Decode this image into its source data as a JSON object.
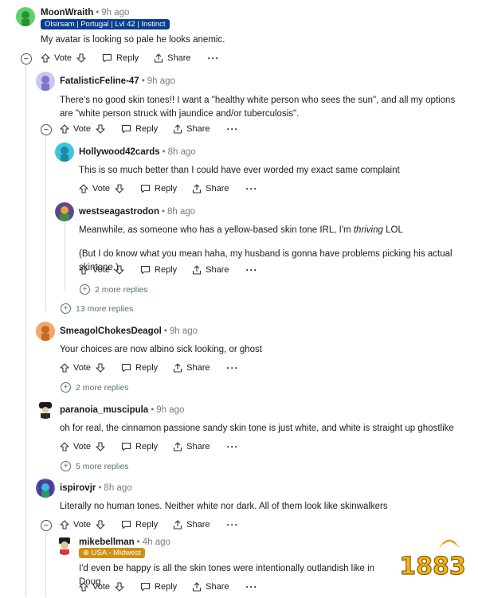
{
  "actions": {
    "vote": "Vote",
    "reply": "Reply",
    "share": "Share",
    "more": "···"
  },
  "comments": [
    {
      "user": "MoonWraith",
      "time": "9h ago",
      "flair": "Olsirsam | Portugal | Lvl 42 | Instinct",
      "text": [
        "My avatar is looking so pale he looks anemic."
      ]
    },
    {
      "user": "FatalisticFeline-47",
      "time": "9h ago",
      "text": [
        "There's no good skin tones!! I want a \"healthy white person who sees the sun\", and all my options are \"white person struck with jaundice and/or tuberculosis\"."
      ]
    },
    {
      "user": "Hollywood42cards",
      "time": "8h ago",
      "text": [
        "This is so much better than I could have ever worded my exact same complaint"
      ]
    },
    {
      "user": "westseagastrodon",
      "time": "8h ago",
      "text_before": "Meanwhile, as someone who has a yellow-based skin tone IRL, I'm ",
      "text_em": "thriving",
      "text_after": " LOL",
      "text2": "(But I do know what you mean haha, my husband is gonna have problems picking his actual skintone.)"
    },
    {
      "user": "SmeagolChokesDeagol",
      "time": "9h ago",
      "text": [
        "Your choices are now albino sick looking, or ghost"
      ]
    },
    {
      "user": "paranoia_muscipula",
      "time": "9h ago",
      "text": [
        "oh for real, the cinnamon passione sandy skin tone is just white, and white is straight up ghostlike"
      ]
    },
    {
      "user": "ispirovjr",
      "time": "8h ago",
      "text": [
        "Literally no human tones. Neither white nor dark. All of them look like skinwalkers"
      ]
    },
    {
      "user": "mikebellman",
      "time": "4h ago",
      "flair": "USA - Midwest",
      "text": [
        "I'd even be happy is all the skin tones were intentionally outlandish like in Doug"
      ]
    }
  ],
  "more_replies": {
    "westseagastrodon": "2 more replies",
    "feline": "13 more replies",
    "smeagol": "2 more replies",
    "paranoia": "5 more replies"
  },
  "colors": {
    "flair_blue": "#0a3d91",
    "flair_gold": "#d08f16",
    "thread_line": "#d7dbdd"
  },
  "watermark": "1883"
}
